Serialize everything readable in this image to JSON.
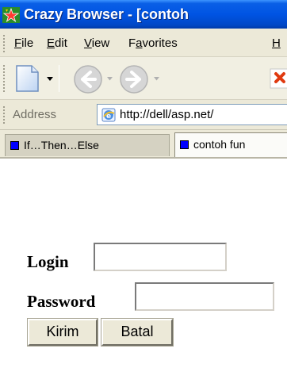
{
  "window": {
    "title": "Crazy Browser - [contoh"
  },
  "menu": {
    "items": [
      {
        "label": "File",
        "mnemonic": "F",
        "rest": "ile"
      },
      {
        "label": "Edit",
        "mnemonic": "E",
        "rest": "dit"
      },
      {
        "label": "View",
        "mnemonic": "V",
        "rest": "iew"
      },
      {
        "label": "Favorites",
        "pre": "F",
        "mnemonic": "a",
        "rest": "vorites"
      },
      {
        "label": "H",
        "mnemonic": "H",
        "rest": ""
      }
    ]
  },
  "toolbar": {
    "buttons": [
      "new-page",
      "back",
      "forward",
      "stop"
    ]
  },
  "address": {
    "label": "Address",
    "url": "http://dell/asp.net/"
  },
  "tabs": [
    {
      "label": "If…Then…Else",
      "active": false
    },
    {
      "label": "contoh fun",
      "active": true
    }
  ],
  "form": {
    "login_label": "Login",
    "login_value": "",
    "password_label": "Password",
    "password_value": "",
    "submit_label": "Kirim",
    "cancel_label": "Batal"
  },
  "colors": {
    "titlebar": "#0054e3",
    "chrome": "#ece9d8",
    "tab_marker": "#0000ff"
  }
}
